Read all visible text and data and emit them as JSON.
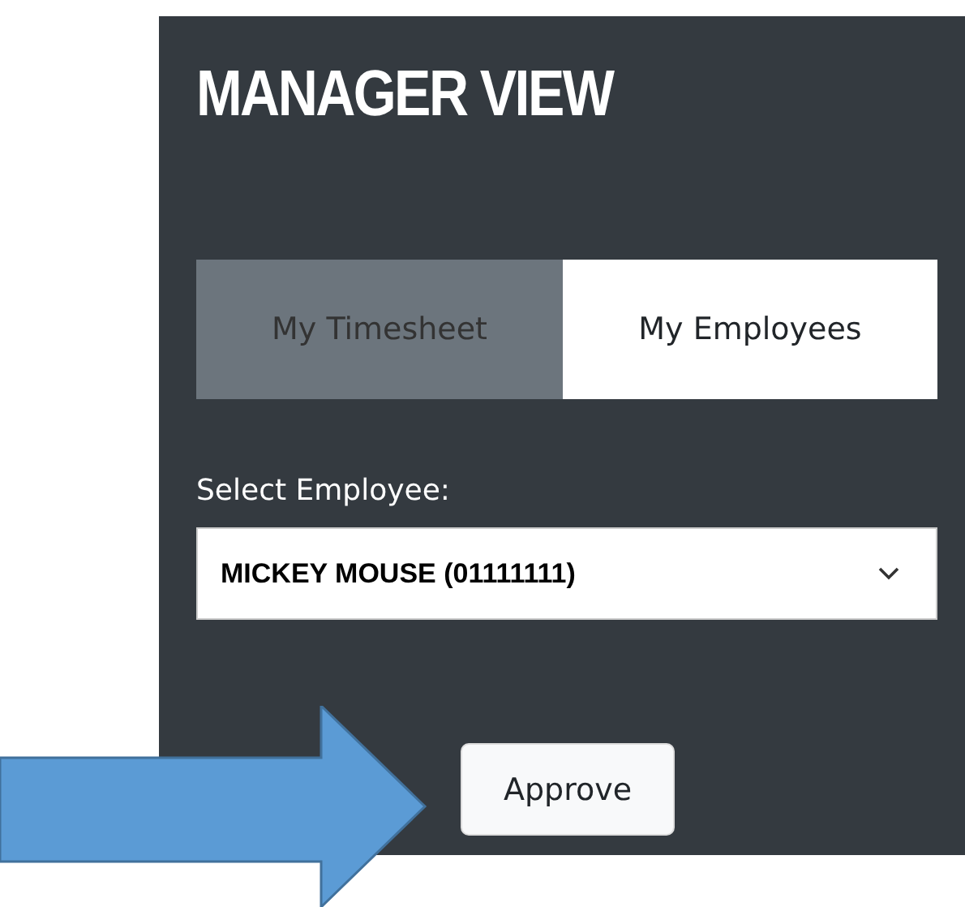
{
  "panel": {
    "title": "MANAGER VIEW"
  },
  "tabs": [
    {
      "label": "My Timesheet",
      "selected": false
    },
    {
      "label": "My Employees",
      "selected": true
    }
  ],
  "employee_select": {
    "label": "Select Employee:",
    "value": "MICKEY MOUSE (01111111)"
  },
  "buttons": [
    "Approve"
  ]
}
